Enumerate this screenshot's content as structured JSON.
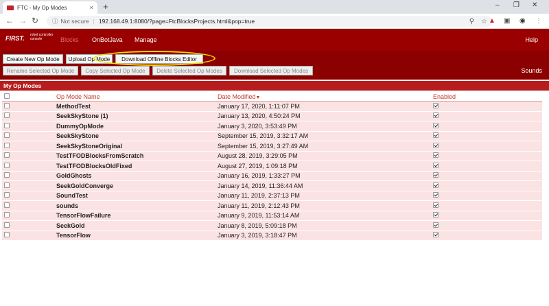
{
  "browser": {
    "tab_title": "FTC - My Op Modes",
    "tab_close": "×",
    "new_tab": "+",
    "not_secure": "Not secure",
    "url": "192.168.49.1:8080/?page=FtcBlocksProjects.html&pop=true",
    "win_min": "–",
    "win_max": "❐",
    "win_close": "✕"
  },
  "header": {
    "logo": "FIRST.",
    "logo_sub": "robot controller console",
    "nav": [
      "Blocks",
      "OnBotJava",
      "Manage"
    ],
    "help": "Help"
  },
  "toolbar": {
    "create": "Create New Op Mode",
    "upload": "Upload Op Mode",
    "download_offline": "Download Offline Blocks Editor",
    "rename": "Rename Selected Op Mode",
    "copy": "Copy Selected Op Mode",
    "delete": "Delete Selected Op Modes",
    "download_selected": "Download Selected Op Modes",
    "sounds": "Sounds"
  },
  "section_title": "My Op Modes",
  "table": {
    "headers": {
      "name": "Op Mode Name",
      "date": "Date Modified",
      "sort_indicator": "▼",
      "enabled": "Enabled"
    },
    "rows": [
      {
        "name": "MethodTest",
        "date": "January 17, 2020, 1:11:07 PM",
        "enabled": true
      },
      {
        "name": "SeekSkyStone (1)",
        "date": "January 13, 2020, 4:50:24 PM",
        "enabled": true
      },
      {
        "name": "DummyOpMode",
        "date": "January 3, 2020, 3:53:49 PM",
        "enabled": true
      },
      {
        "name": "SeekSkyStone",
        "date": "September 15, 2019, 3:32:17 AM",
        "enabled": true
      },
      {
        "name": "SeekSkyStoneOriginal",
        "date": "September 15, 2019, 3:27:49 AM",
        "enabled": true
      },
      {
        "name": "TestTFODBlocksFromScratch",
        "date": "August 28, 2019, 3:29:05 PM",
        "enabled": true
      },
      {
        "name": "TestTFODBlocksOldFixed",
        "date": "August 27, 2019, 1:09:18 PM",
        "enabled": true
      },
      {
        "name": "GoldGhosts",
        "date": "January 16, 2019, 1:33:27 PM",
        "enabled": true
      },
      {
        "name": "SeekGoldConverge",
        "date": "January 14, 2019, 11:36:44 AM",
        "enabled": true
      },
      {
        "name": "SoundTest",
        "date": "January 11, 2019, 2:37:13 PM",
        "enabled": true
      },
      {
        "name": "sounds",
        "date": "January 11, 2019, 2:12:43 PM",
        "enabled": true
      },
      {
        "name": "TensorFlowFailure",
        "date": "January 9, 2019, 11:53:14 AM",
        "enabled": true
      },
      {
        "name": "SeekGold",
        "date": "January 8, 2019, 5:09:18 PM",
        "enabled": true
      },
      {
        "name": "TensorFlow",
        "date": "January 3, 2019, 3:18:47 PM",
        "enabled": true
      }
    ]
  }
}
